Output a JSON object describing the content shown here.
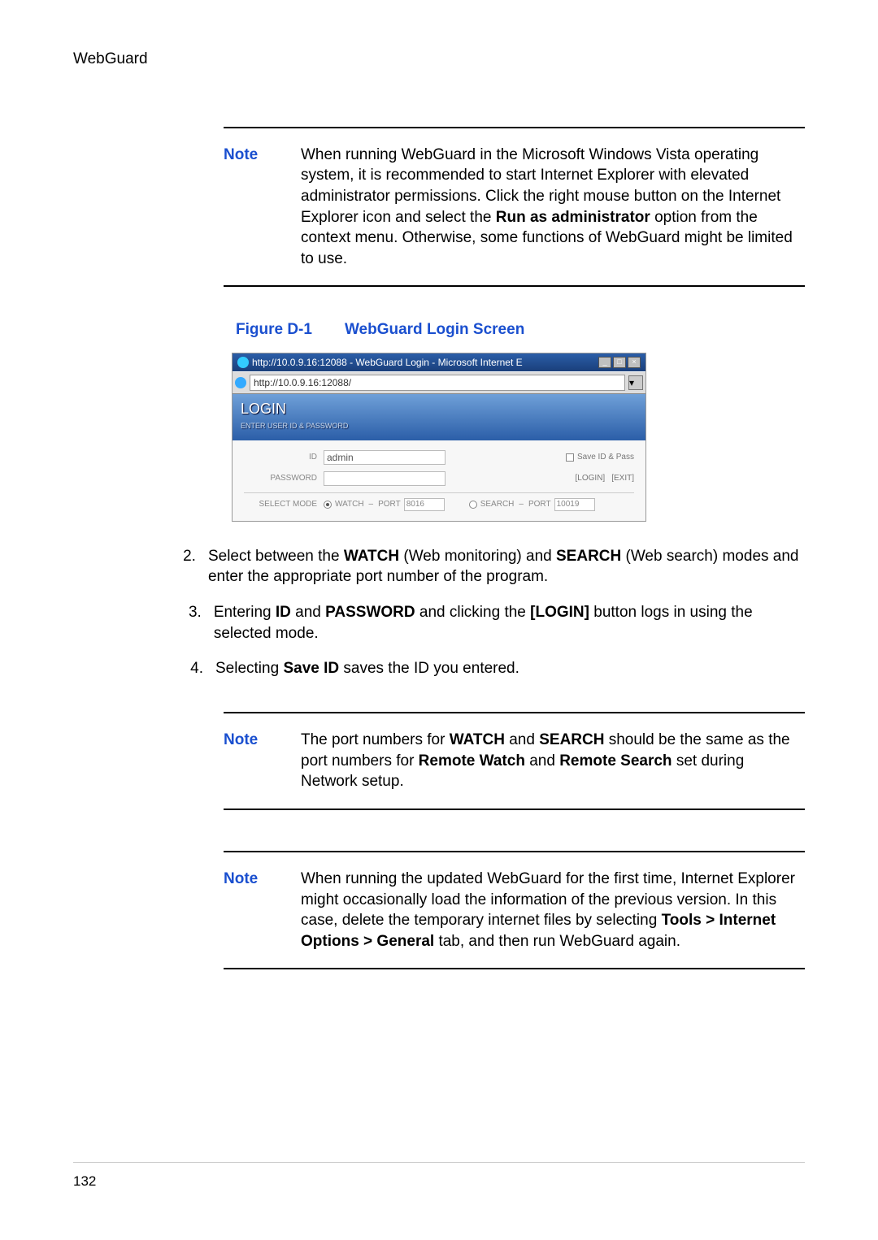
{
  "section_header": "WebGuard",
  "note1": {
    "label": "Note",
    "text_plain": "When running WebGuard in the Microsoft Windows Vista operating system, it is recommended to start Internet Explorer with elevated administrator permissions. Click the right mouse button on the Internet Explorer icon and select the ",
    "bold1": "Run as administrator",
    "text_cont": " option from the context menu. Otherwise, some functions of WebGuard might be limited to use."
  },
  "figure": {
    "id": "Figure D-1",
    "title": "WebGuard Login Screen"
  },
  "screenshot": {
    "titlebar": "http://10.0.9.16:12088 - WebGuard Login - Microsoft Internet E",
    "addr": "http://10.0.9.16:12088/",
    "login_header": "LOGIN",
    "login_sub": "ENTER USER ID & PASSWORD",
    "id_label": "ID",
    "id_value": "admin",
    "pw_label": "PASSWORD",
    "save_label": "Save ID & Pass",
    "btn_login": "[LOGIN]",
    "btn_exit": "[EXIT]",
    "mode_label": "SELECT MODE",
    "watch": "WATCH",
    "search": "SEARCH",
    "port_label": "PORT",
    "watch_port": "8016",
    "search_port": "10019"
  },
  "steps": {
    "s2a": "Select between the ",
    "s2_b1": "WATCH",
    "s2b": " (Web monitoring) and ",
    "s2_b2": "SEARCH",
    "s2c": " (Web search) modes and enter the appropriate port number of the program.",
    "s3a": "Entering ",
    "s3_b1": "ID",
    "s3b": " and ",
    "s3_b2": "PASSWORD",
    "s3c": " and clicking the ",
    "s3_b3": "[LOGIN]",
    "s3d": " button logs in using the selected mode.",
    "s4a": "Selecting ",
    "s4_b1": "Save ID",
    "s4b": " saves the ID you entered."
  },
  "note2": {
    "a": "The port numbers for ",
    "b1": "WATCH",
    "b": " and ",
    "b2": "SEARCH",
    "c": " should be the same as the port numbers for ",
    "b3": "Remote Watch",
    "d": " and ",
    "b4": "Remote Search",
    "e": " set during Network setup."
  },
  "note3": {
    "a": "When running the updated WebGuard for the first time, Internet Explorer might occasionally load the information of the previous version. In this case, delete the temporary internet files by selecting ",
    "b1": "Tools > Internet Options > General",
    "b": " tab, and then run WebGuard again."
  },
  "page_number": "132"
}
